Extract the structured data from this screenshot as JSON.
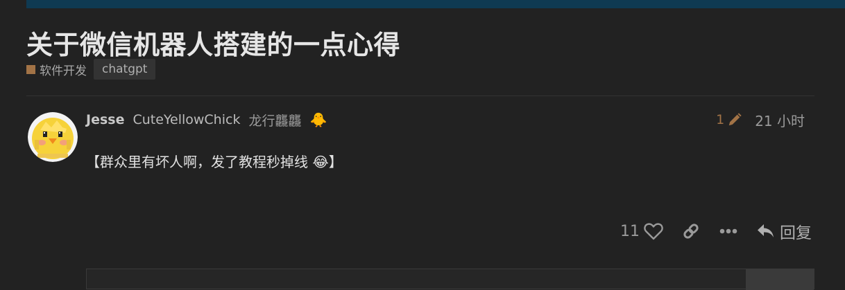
{
  "topic": {
    "title": "关于微信机器人搭建的一点心得",
    "category": "软件开发",
    "tag": "chatgpt"
  },
  "post": {
    "username": "Jesse",
    "full_name": "CuteYellowChick",
    "user_title": "龙行龘龘",
    "flair_emoji": "🐥",
    "edit_count": "1",
    "post_date": "21 小时",
    "body": "【群众里有坏人啊，发了教程秒掉线 😂】",
    "likes": "11",
    "reply_label": "回复"
  },
  "icons": {
    "avatar": "pixel-yellow-chick-avatar",
    "edit": "pencil-icon",
    "like": "heart-icon",
    "share": "link-icon",
    "more": "ellipsis-icon",
    "reply": "reply-arrow-icon"
  },
  "colors": {
    "background": "#222222",
    "header_bar": "#0f3a52",
    "category": "#a27346",
    "edit": "#a27346"
  }
}
